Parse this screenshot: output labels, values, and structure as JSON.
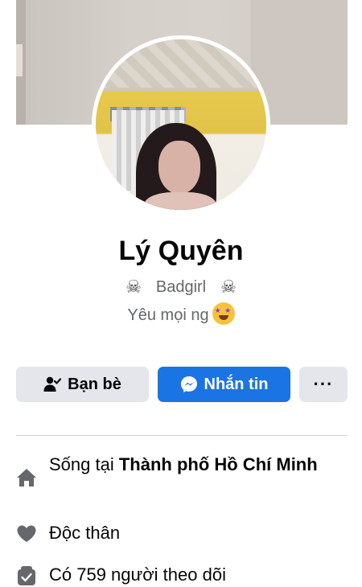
{
  "profile": {
    "name": "Lý Quyên",
    "bio_line1": "Badgirl",
    "bio_line2": "Yêu mọi ng",
    "skull_glyph": "☠"
  },
  "actions": {
    "friends_label": "Bạn bè",
    "message_label": "Nhắn tin",
    "more_label": "···"
  },
  "intro": {
    "lives_prefix": "Sống tại ",
    "lives_city": "Thành phố Hồ Chí Minh",
    "relationship": "Độc thân",
    "followers": "Có 759 người theo dõi"
  },
  "colors": {
    "accent": "#1b74e4",
    "button_gray": "#e4e6eb",
    "icon_gray": "#65676b"
  }
}
